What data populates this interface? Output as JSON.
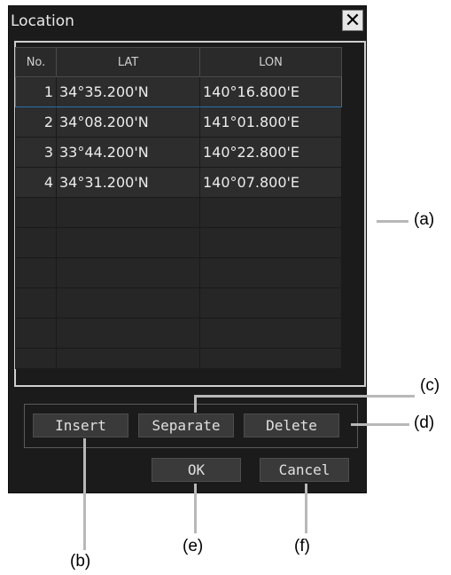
{
  "dialog": {
    "title": "Location",
    "close_label": "✕"
  },
  "table": {
    "columns": [
      "No.",
      "LAT",
      "LON"
    ],
    "rows": [
      {
        "no": "1",
        "lat": "34°35.200'N",
        "lon": "140°16.800'E"
      },
      {
        "no": "2",
        "lat": "34°08.200'N",
        "lon": "141°01.800'E"
      },
      {
        "no": "3",
        "lat": "33°44.200'N",
        "lon": "140°22.800'E"
      },
      {
        "no": "4",
        "lat": "34°31.200'N",
        "lon": "140°07.800'E"
      }
    ],
    "selected_row": 1
  },
  "buttons": {
    "insert": "Insert",
    "separate": "Separate",
    "delete": "Delete",
    "ok": "OK",
    "cancel": "Cancel"
  },
  "callouts": {
    "a": "(a)",
    "b": "(b)",
    "c": "(c)",
    "d": "(d)",
    "e": "(e)",
    "f": "(f)"
  },
  "colors": {
    "dialog_bg": "#1b1b1b",
    "cell_bg": "#2d2d2d",
    "selection": "#2a6fb0",
    "leader_line": "#b8b8b8"
  }
}
